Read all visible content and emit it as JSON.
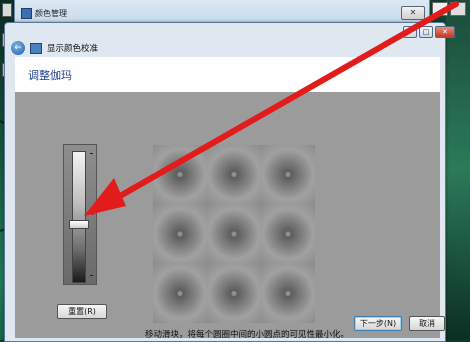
{
  "back_window": {
    "title": "颜色管理",
    "close_label": "✕"
  },
  "dialog": {
    "nav_title": "显示颜色校准",
    "heading": "调整伽玛",
    "window_buttons": {
      "minimize": "–",
      "maximize": "□",
      "close": "✕"
    },
    "slider": {
      "level_fraction": 0.55
    },
    "reset_label": "重置(R)",
    "instruction": "移动滑块，将每个圆圈中间的小圆点的可见性最小化。",
    "buttons": {
      "next": "下一步(N)",
      "cancel": "取消"
    }
  },
  "annotation": {
    "arrow_color": "#e21b1b"
  }
}
